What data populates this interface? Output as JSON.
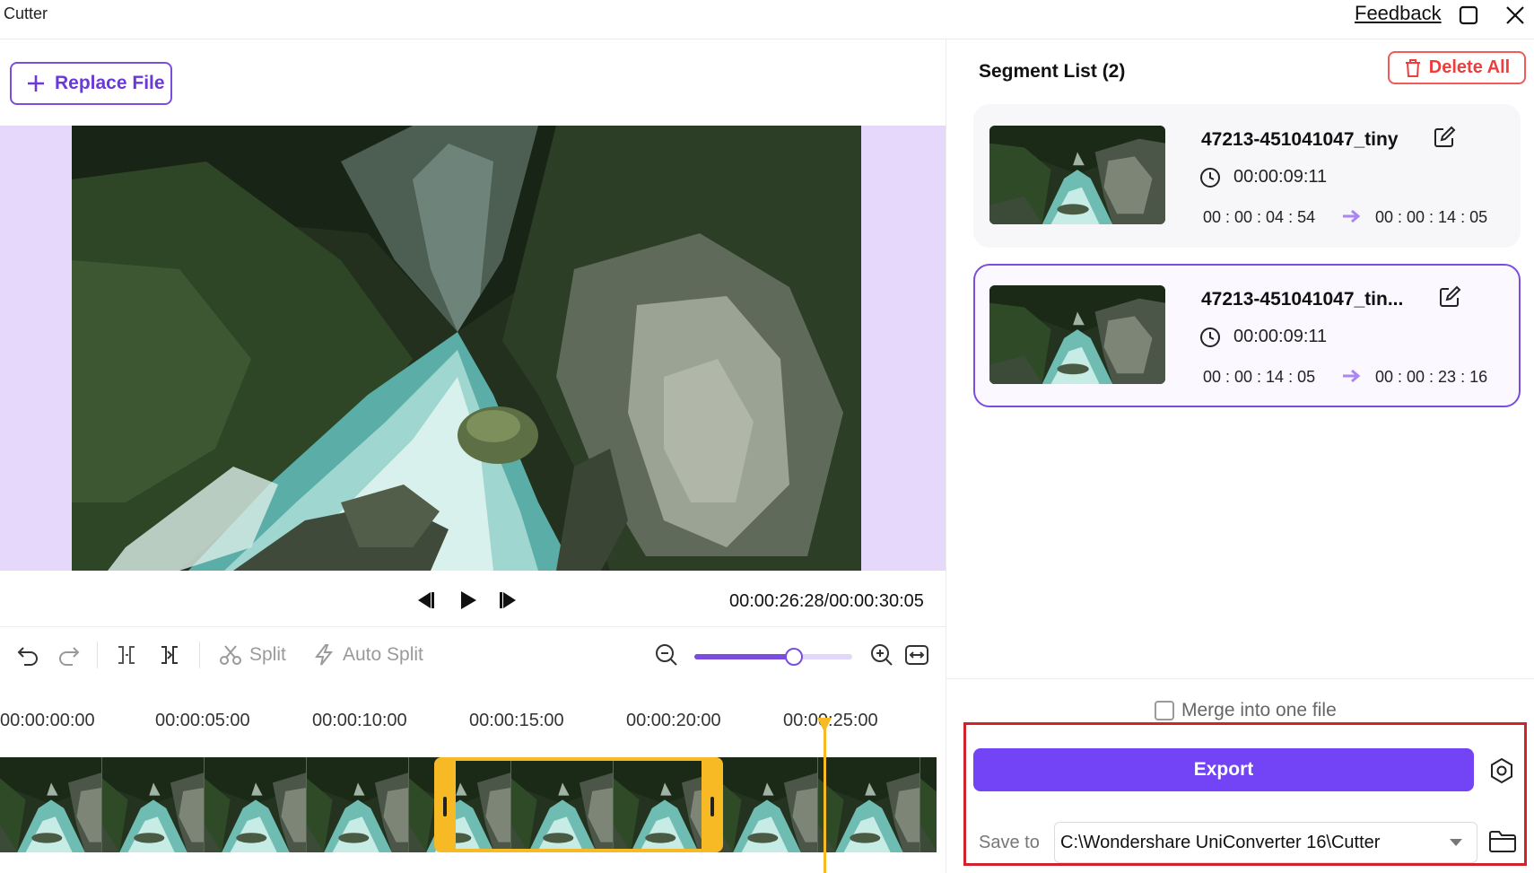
{
  "app": {
    "title": "Cutter"
  },
  "titlebar": {
    "feedback_label": "Feedback",
    "maximize_icon": "maximize-icon",
    "close_icon": "close-icon"
  },
  "left": {
    "replace_file_label": "Replace File",
    "preview_description_hidden": false,
    "playback": {
      "timecode": "00:00:26:28/00:00:30:05"
    },
    "toolbar": {
      "split_label": "Split",
      "auto_split_label": "Auto Split",
      "zoom_level_fraction": 0.63
    },
    "ruler": {
      "ticks": [
        "00:00:00:00",
        "00:00:05:00",
        "00:00:10:00",
        "00:00:15:00",
        "00:00:20:00",
        "00:00:25:00"
      ]
    },
    "timeline": {
      "selection_start": "00:00:14:05",
      "selection_end": "00:00:23:16",
      "playhead": "00:00:26:28"
    }
  },
  "segments": {
    "title": "Segment List (2)",
    "delete_all_label": "Delete All",
    "items": [
      {
        "name": "47213-451041047_tiny",
        "duration": "00:00:09:11",
        "start": "00 : 00 : 04 : 54",
        "end": "00 : 00 : 14 : 05",
        "selected": false
      },
      {
        "name": "47213-451041047_tin...",
        "duration": "00:00:09:11",
        "start": "00 : 00 : 14 : 05",
        "end": "00 : 00 : 23 : 16",
        "selected": true
      }
    ]
  },
  "output": {
    "merge_label": "Merge into one file",
    "merge_checked": false,
    "export_label": "Export",
    "save_to_label": "Save to",
    "save_path": "C:\\Wondershare UniConverter 16\\Cutter"
  },
  "colors": {
    "accent": "#7244f5",
    "accent_border": "#7b4dde",
    "delete_red": "#ef3d3d",
    "selection_yellow": "#f7b924",
    "highlight_red": "#d0242c",
    "preview_bg": "#e5d8fb"
  }
}
